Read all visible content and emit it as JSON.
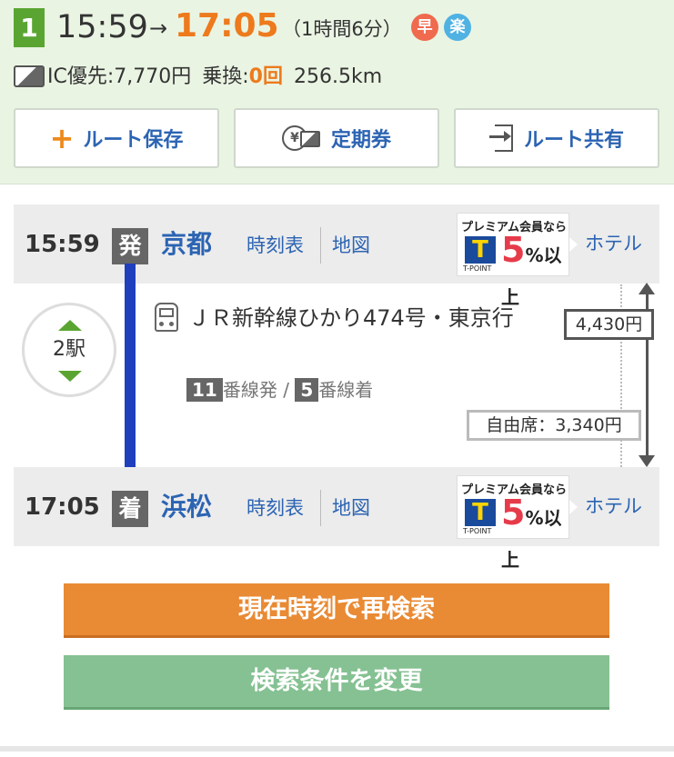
{
  "summary": {
    "route_number": "1",
    "departure_time": "15:59",
    "arrow": "→",
    "arrival_time": "17:05",
    "duration": "（1時間6分）",
    "badges": {
      "fast": "早",
      "easy": "楽"
    },
    "fare_label": "IC優先:",
    "fare_value": "7,770円",
    "transfer_label": "乗換:",
    "transfer_value": "0回",
    "distance": "256.5km"
  },
  "actions": {
    "save_label": "ルート保存",
    "save_icon": "+",
    "commuter_pass_label": "定期券",
    "share_label": "ルート共有",
    "yen_symbol": "¥"
  },
  "departure": {
    "time": "15:59",
    "mark": "発",
    "station": "京都",
    "timetable_link": "時刻表",
    "map_link": "地図",
    "hotel_link": "ホテル"
  },
  "arrival": {
    "time": "17:05",
    "mark": "着",
    "station": "浜松",
    "timetable_link": "時刻表",
    "map_link": "地図",
    "hotel_link": "ホテル"
  },
  "tpoint_ad": {
    "headline": "プレミアム会員なら",
    "logo": "T",
    "percent": "5",
    "percent_suffix": "%以上",
    "brand": "T-POINT"
  },
  "segment": {
    "stops": "2駅",
    "train_name": "ＪＲ新幹線ひかり474号・東京行",
    "departure_platform": "11",
    "departure_platform_suffix": "番線発",
    "platform_separator": "/",
    "arrival_platform": "5",
    "arrival_platform_suffix": "番線着",
    "fare": "4,430円",
    "seat_fare": "自由席：3,340円"
  },
  "buttons": {
    "research_now": "現在時刻で再検索",
    "change_conditions": "検索条件を変更"
  },
  "colors": {
    "accent_orange": "#ed7a1c",
    "link_blue": "#2c64b3",
    "green": "#5aa532",
    "line_blue": "#1f3fbd"
  }
}
